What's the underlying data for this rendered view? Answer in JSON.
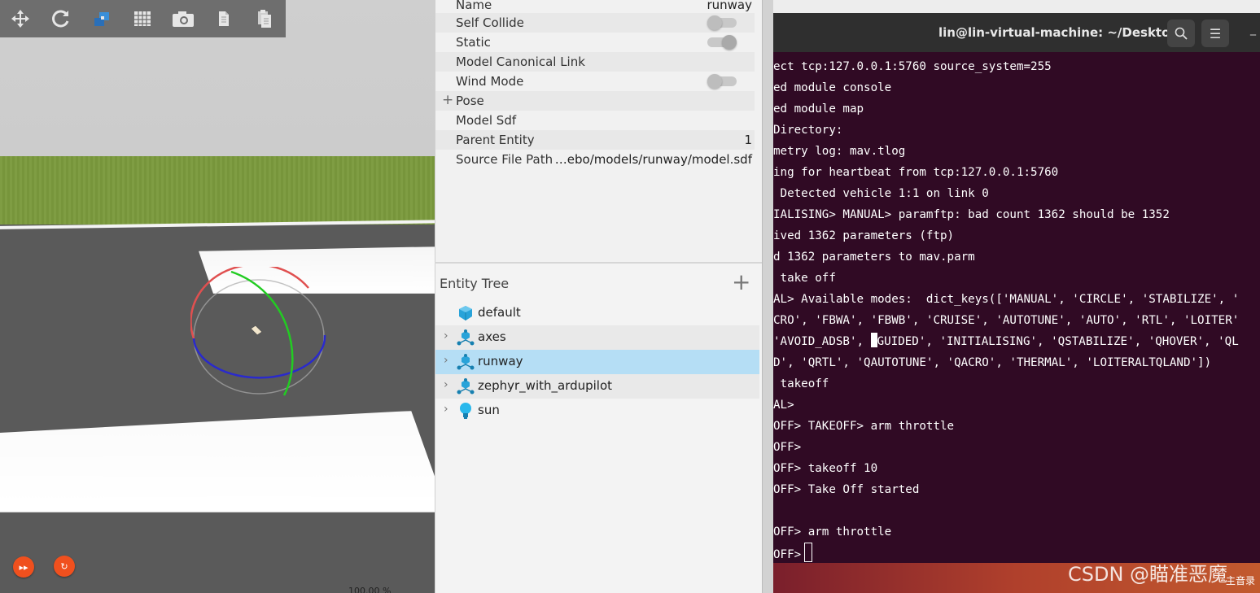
{
  "viewport": {
    "toolbar": [
      {
        "name": "translate-tool",
        "icon": "move-icon"
      },
      {
        "name": "rotate-tool",
        "icon": "rotate-icon"
      },
      {
        "name": "insert-model-tool",
        "icon": "model-icon"
      },
      {
        "name": "grid-tool",
        "icon": "grid-icon"
      },
      {
        "name": "screenshot-tool",
        "icon": "camera-icon"
      },
      {
        "name": "copy-tool",
        "icon": "copy-icon"
      },
      {
        "name": "paste-tool",
        "icon": "paste-icon"
      }
    ],
    "play_icon": "▸▸",
    "step_icon": "↻",
    "rtf": "100.00 %"
  },
  "inspector": {
    "properties": [
      {
        "label": "Name",
        "value": "runway"
      },
      {
        "label": "Self Collide",
        "toggle": "off"
      },
      {
        "label": "Static",
        "toggle": "on"
      },
      {
        "label": "Model Canonical Link",
        "value": ""
      },
      {
        "label": "Wind Mode",
        "toggle": "off"
      },
      {
        "label": "Pose",
        "expandable": true
      },
      {
        "label": "Model Sdf",
        "value": ""
      },
      {
        "label": "Parent Entity",
        "value": "1"
      },
      {
        "label": "Source File Path",
        "value": "…ebo/models/runway/model.sdf"
      }
    ],
    "pose_expander": "+"
  },
  "entity_tree": {
    "title": "Entity Tree",
    "add_label": "+",
    "items": [
      {
        "name": "default",
        "icon": "world-cube-icon",
        "expandable": false,
        "selected": false
      },
      {
        "name": "axes",
        "icon": "model-icon",
        "expandable": true,
        "selected": false
      },
      {
        "name": "runway",
        "icon": "model-icon",
        "expandable": true,
        "selected": true
      },
      {
        "name": "zephyr_with_ardupilot",
        "icon": "model-icon",
        "expandable": true,
        "selected": false
      },
      {
        "name": "sun",
        "icon": "light-bulb-icon",
        "expandable": true,
        "selected": false
      }
    ],
    "arrow": "›"
  },
  "terminal": {
    "title": "lin@lin-virtual-machine: ~/Desktop",
    "minimize": "_",
    "menu": "☰",
    "lines": [
      "ect tcp:127.0.0.1:5760 source_system=255",
      "ed module console",
      "ed module map",
      "Directory:",
      "metry log: mav.tlog",
      "ing for heartbeat from tcp:127.0.0.1:5760",
      " Detected vehicle 1:1 on link 0",
      "IALISING> MANUAL> paramftp: bad count 1362 should be 1352",
      "ived 1362 parameters (ftp)",
      "d 1362 parameters to mav.parm",
      " take off",
      "AL> Available modes:  dict_keys(['MANUAL', 'CIRCLE', 'STABILIZE', '",
      "CRO', 'FBWA', 'FBWB', 'CRUISE', 'AUTOTUNE', 'AUTO', 'RTL', 'LOITER'",
      "'AVOID_ADSB', ",
      "D', 'QRTL', 'QAUTOTUNE', 'QACRO', 'THERMAL', 'LOITERALTQLAND'])",
      " takeoff",
      "AL>",
      "OFF> TAKEOFF> arm throttle",
      "OFF>",
      "OFF> takeoff 10",
      "OFF> Take Off started",
      "",
      "OFF> arm throttle",
      "OFF>"
    ],
    "line14_rest": "GUIDED', 'INITIALISING', 'QSTABILIZE', 'QHOVER', 'QL"
  },
  "watermark": "CSDN @瞄准恶魔",
  "tray": "主音录"
}
